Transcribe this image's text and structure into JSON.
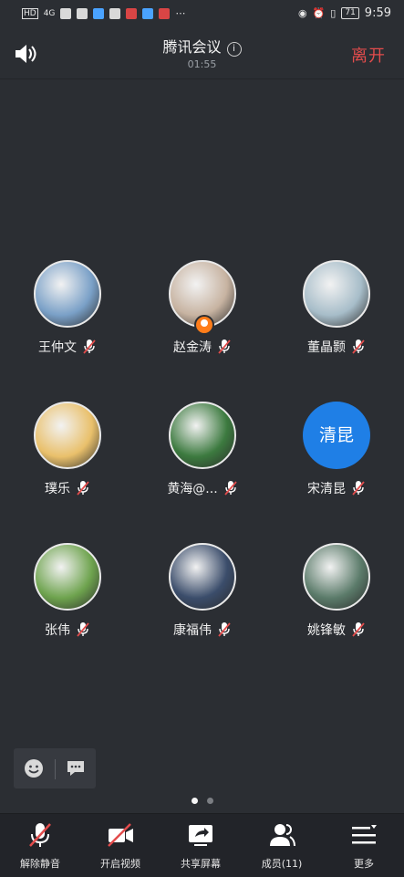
{
  "status_bar": {
    "left_items": [
      "HD",
      "4G",
      "signal-icon",
      "hotspot-icon",
      "cloud-icon",
      "box-icon",
      "recorder-icon",
      "tv-icon",
      "mail-icon",
      "more-icon"
    ],
    "battery": "71",
    "time": "9:59"
  },
  "header": {
    "title": "腾讯会议",
    "timer": "01:55",
    "leave_label": "离开"
  },
  "participants": [
    {
      "name": "王仲文",
      "muted": true,
      "avatar_color": "#7aa0c7"
    },
    {
      "name": "赵金涛",
      "muted": true,
      "host": true,
      "avatar_color": "#c7b3a1"
    },
    {
      "name": "董晶颢",
      "muted": true,
      "avatar_color": "#a7bdc9"
    },
    {
      "name": "璞乐",
      "muted": true,
      "avatar_color": "#e9c06b"
    },
    {
      "name": "黄海@...",
      "muted": true,
      "avatar_color": "#3c7a3f"
    },
    {
      "name": "宋清昆",
      "muted": true,
      "avatar_text": "清昆",
      "avatar_color": "#1f7fe6"
    },
    {
      "name": "张伟",
      "muted": true,
      "avatar_color": "#6ea34e"
    },
    {
      "name": "康福伟",
      "muted": true,
      "avatar_color": "#3b4d6b"
    },
    {
      "name": "姚锋敏",
      "muted": true,
      "avatar_color": "#5b7b6a"
    }
  ],
  "pager": {
    "pages": 2,
    "current": 1
  },
  "toolbar": {
    "unmute_label": "解除静音",
    "video_label": "开启视频",
    "share_label": "共享屏幕",
    "members_label": "成员(11)",
    "more_label": "更多"
  },
  "colors": {
    "background": "#2b2e33",
    "leave": "#e24c4c",
    "host_badge": "#ff7d1a",
    "accent": "#1f7fe6",
    "muted_mic": "#e24c4c"
  }
}
